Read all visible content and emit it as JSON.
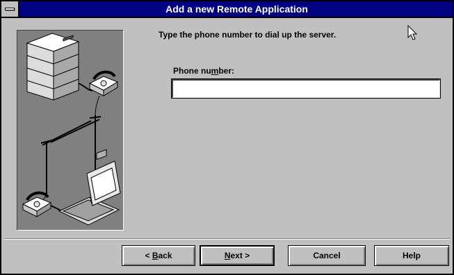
{
  "window": {
    "title": "Add a new Remote Application"
  },
  "content": {
    "instruction": "Type the phone number to dial up the server.",
    "phone_label": {
      "before": "Phone nu",
      "accel": "m",
      "after": "ber:"
    },
    "phone_value": ""
  },
  "buttons": {
    "back": {
      "before": "< ",
      "accel": "B",
      "after": "ack"
    },
    "next": {
      "before": "",
      "accel": "N",
      "after": "ext >"
    },
    "cancel": "Cancel",
    "help": "Help"
  },
  "icons": {
    "system_menu": "system-menu-icon",
    "illustration": "server-modem-laptop-illustration",
    "cursor": "arrow-cursor-icon"
  },
  "colors": {
    "titlebar": "#000080",
    "face": "#c0c0c0",
    "illustration_bg": "#808080"
  }
}
